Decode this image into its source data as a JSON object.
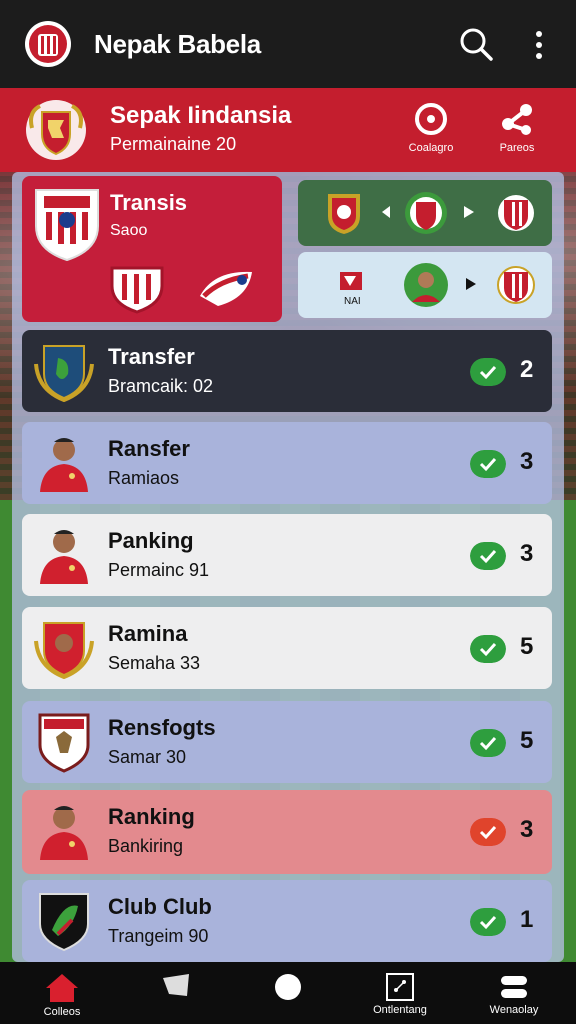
{
  "appbar": {
    "title": "Nepak Babela",
    "icons": [
      "club-logo-icon",
      "search-icon",
      "more-vert-icon"
    ]
  },
  "banner": {
    "name": "Sepak Iindansia",
    "subtitle": "Permainaine 20",
    "actions": [
      {
        "label": "Coalagro",
        "icon": "target-icon"
      },
      {
        "label": "Pareos",
        "icon": "share-icon"
      }
    ]
  },
  "featured": {
    "title": "Transis",
    "subtitle": "Saoo"
  },
  "match2": {
    "label": "NAI"
  },
  "rows": [
    {
      "title": "Transfer",
      "subtitle": "Bramcaik: 02",
      "count": "2",
      "status": "check",
      "style": "dark"
    },
    {
      "title": "Ransfer",
      "subtitle": "Ramiaos",
      "count": "3",
      "status": "check",
      "style": "blue"
    },
    {
      "title": "Panking",
      "subtitle": "Permainc 91",
      "count": "3",
      "status": "check",
      "style": "white"
    },
    {
      "title": "Ramina",
      "subtitle": "Semaha 33",
      "count": "5",
      "status": "check",
      "style": "white"
    },
    {
      "title": "Rensfogts",
      "subtitle": "Samar 30",
      "count": "5",
      "status": "check",
      "style": "blue"
    },
    {
      "title": "Ranking",
      "subtitle": "Bankiring",
      "count": "3",
      "status": "alert",
      "style": "red"
    },
    {
      "title": "Club Club",
      "subtitle": "Trangeim 90",
      "count": "1",
      "status": "check",
      "style": "blue"
    }
  ],
  "bottomnav": [
    {
      "label": "Colleos",
      "icon": "home-icon"
    },
    {
      "label": "",
      "icon": "ticket-icon"
    },
    {
      "label": "",
      "icon": "circle-icon"
    },
    {
      "label": "Ontlentang",
      "icon": "tactics-icon"
    },
    {
      "label": "Wenaolay",
      "icon": "menu-icon"
    }
  ],
  "colors": {
    "primary": "#c41e2e",
    "dark": "#1c1c1c",
    "check": "#2e9e3e",
    "alert": "#e0442c"
  }
}
